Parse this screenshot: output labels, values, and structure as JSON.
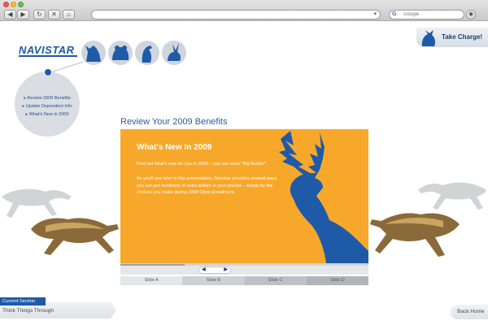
{
  "browser": {
    "search_placeholder": "Google",
    "nav": {
      "back": "◀",
      "forward": "▶",
      "reload": "↻",
      "stop": "✕",
      "home": "⌂"
    },
    "icons": [
      "back-arrow-icon",
      "forward-arrow-icon",
      "reload-icon",
      "stop-icon",
      "home-icon",
      "dropdown-arrow-icon",
      "google-icon",
      "menu-icon"
    ]
  },
  "header": {
    "logo": "NAVISTAR",
    "take_charge": "Take Charge!",
    "animal_icons": [
      "wolf-icon",
      "bear-icon",
      "eagle-icon",
      "jackrabbit-icon"
    ]
  },
  "side_nav": {
    "links": [
      "Review 2009 Benefits",
      "Update Dependent Info",
      "What's New in 2009"
    ]
  },
  "main": {
    "page_title": "Review Your 2009 Benefits",
    "slide": {
      "heading": "What's New In 2009",
      "paragraph_1": "Find out what's new for you in 2009 – you can save \"Big Bucks!\"",
      "paragraph_2": "As you'll see later in this presentation, Navistar provides several ways you can put hundreds of extra dollars in your pocket – simply by the choices you make during 2009 Open Enrollment."
    },
    "progress": 0.26,
    "tabs": [
      "Slide A",
      "Slide B",
      "Slide C",
      "Slide D"
    ]
  },
  "footer": {
    "current_section_label": "Current Section",
    "current_section_name": "Think Things Through",
    "back_home": "Back Home"
  },
  "colors": {
    "brand_blue": "#1e5aa8",
    "slide_orange": "#f7a82a",
    "deer_blue": "#1e5aa8"
  }
}
